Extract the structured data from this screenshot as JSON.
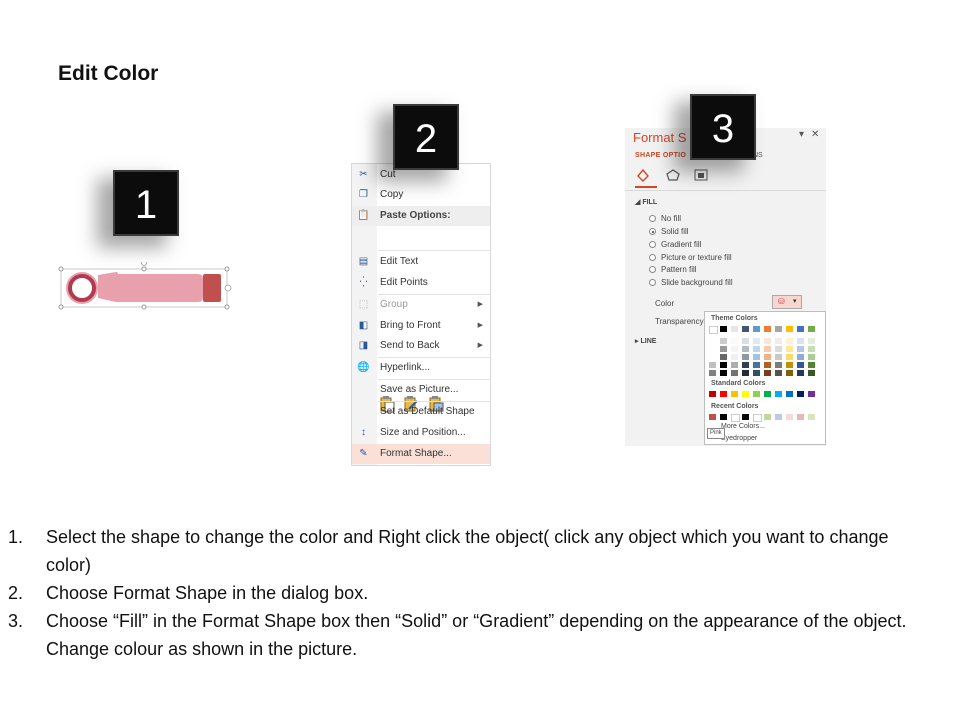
{
  "title": "Edit Color",
  "badges": [
    "1",
    "2",
    "3"
  ],
  "context_menu": {
    "items": [
      {
        "label": "Cut",
        "icon": "scissors-icon"
      },
      {
        "label": "Copy",
        "icon": "copy-icon"
      },
      {
        "label": "Paste Options:",
        "icon": "paste-icon"
      },
      {
        "label": "Edit Text",
        "icon": "edit-text-icon"
      },
      {
        "label": "Edit Points",
        "icon": "edit-points-icon"
      },
      {
        "label": "Group",
        "icon": "group-icon"
      },
      {
        "label": "Bring to Front",
        "icon": "bring-to-front-icon"
      },
      {
        "label": "Send to Back",
        "icon": "send-to-back-icon"
      },
      {
        "label": "Hyperlink...",
        "icon": "hyperlink-icon"
      },
      {
        "label": "Save as Picture..."
      },
      {
        "label": "Set as Default Shape"
      },
      {
        "label": "Size and Position...",
        "icon": "size-position-icon"
      },
      {
        "label": "Format Shape...",
        "icon": "format-shape-icon"
      }
    ]
  },
  "format_pane": {
    "title": "Format S",
    "subtitle": "SHAPE OPTIO",
    "subtitle2": "NS",
    "fill_section": "FILL",
    "fill_options": [
      "No fill",
      "Solid fill",
      "Gradient fill",
      "Picture or texture fill",
      "Pattern fill",
      "Slide background fill"
    ],
    "selected_fill": "Solid fill",
    "color_label": "Color",
    "transparency_label": "Transparency",
    "line_section": "LINE"
  },
  "color_dropdown": {
    "theme_colors_label": "Theme Colors",
    "standard_colors_label": "Standard Colors",
    "recent_colors_label": "Recent Colors",
    "more_colors": "More Colors...",
    "eyedropper": "Eyedropper",
    "tooltip": "Pink",
    "theme_top": [
      "#ffffff",
      "#000000",
      "#e7e6e6",
      "#44546a",
      "#5b9bd5",
      "#ed7d31",
      "#a5a5a5",
      "#ffc000",
      "#4472c4",
      "#70ad47"
    ],
    "standard": [
      "#c00000",
      "#ff0000",
      "#ffc000",
      "#ffff00",
      "#92d050",
      "#00b050",
      "#00b0f0",
      "#0070c0",
      "#002060",
      "#7030a0"
    ],
    "recent": [
      "#c0504d",
      "#000000",
      "#ffffff",
      "#000000",
      "#ffffff",
      "#c4d79b",
      "#b8cce4",
      "#f2dcdb",
      "#e6b8b7",
      "#d8e4bc"
    ]
  },
  "colors": {
    "accent": "#d24726",
    "shape_fill": "#e8a0ad",
    "shape_outline": "#b23a4f"
  },
  "steps": [
    {
      "num": "1.",
      "text": "Select the shape to change the color and Right click the object( click any object which you want to change color)"
    },
    {
      "num": "2.",
      "text": "Choose Format Shape in the dialog box."
    },
    {
      "num": "3.",
      "text": "Choose “Fill” in the Format Shape box then “Solid” or “Gradient” depending on the appearance of the object. Change colour as shown in the picture."
    }
  ]
}
